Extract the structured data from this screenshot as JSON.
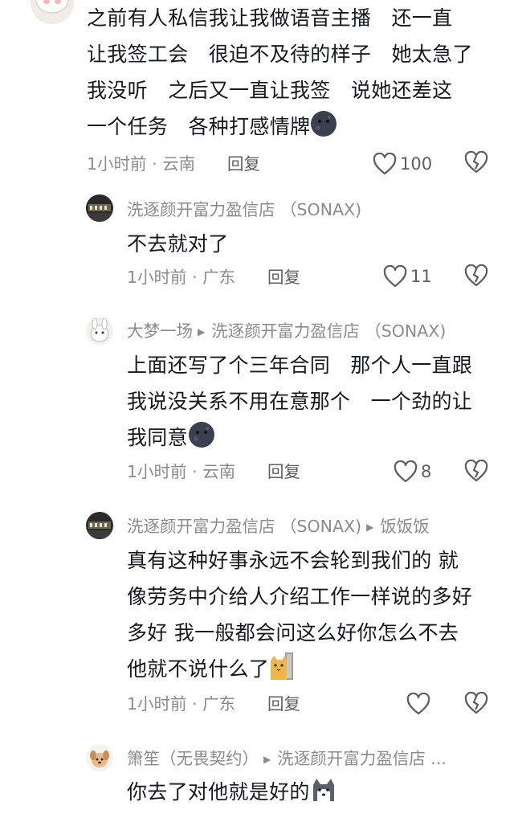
{
  "comments": [
    {
      "text_lines": [
        "之前有人私信我让我做语音主播　还一直",
        "让我签工会　很迫不及待的样子　她太急了",
        "我没听　之后又一直让我签　说她还差这",
        "一个任务　各种打感情牌"
      ],
      "trailing_emoji": "dark-moon-face",
      "time": "1小时前",
      "location": "云南",
      "reply_label": "回复",
      "likes": "100"
    },
    {
      "author": "洗逐颜开富力盈信店 （SONAX)",
      "text_lines": [
        "不去就对了"
      ],
      "time": "1小时前",
      "location": "广东",
      "reply_label": "回复",
      "likes": "11"
    },
    {
      "author": "大梦一场",
      "reply_to": "洗逐颜开富力盈信店 （SONAX)",
      "text_lines": [
        "上面还写了个三年合同　那个人一直跟",
        "我说没关系不用在意那个　一个劲的让",
        "我同意"
      ],
      "trailing_emoji": "dark-moon-face",
      "time": "1小时前",
      "location": "云南",
      "reply_label": "回复",
      "likes": "8"
    },
    {
      "author": "洗逐颜开富力盈信店 （SONAX)",
      "reply_to": "饭饭饭",
      "text_lines": [
        "真有这种好事永远不会轮到我们的 就",
        "像劳务中介给人介绍工作一样说的多好",
        "多好 我一般都会问这么好你怎么不去",
        "他就不说什么了"
      ],
      "trailing_emoji": "cat-peeking",
      "time": "1小时前",
      "location": "广东",
      "reply_label": "回复",
      "likes": ""
    },
    {
      "author": "箫笙（无畏契约）",
      "reply_to": "洗逐颜开富力盈信店 ...",
      "text_lines": [
        "你去了对他就是好的"
      ],
      "trailing_emoji": "husky-dog"
    }
  ],
  "meta_separator": " · ",
  "colors": {
    "text": "#161823",
    "muted": "#8a8b91",
    "action": "#5c5d63"
  }
}
